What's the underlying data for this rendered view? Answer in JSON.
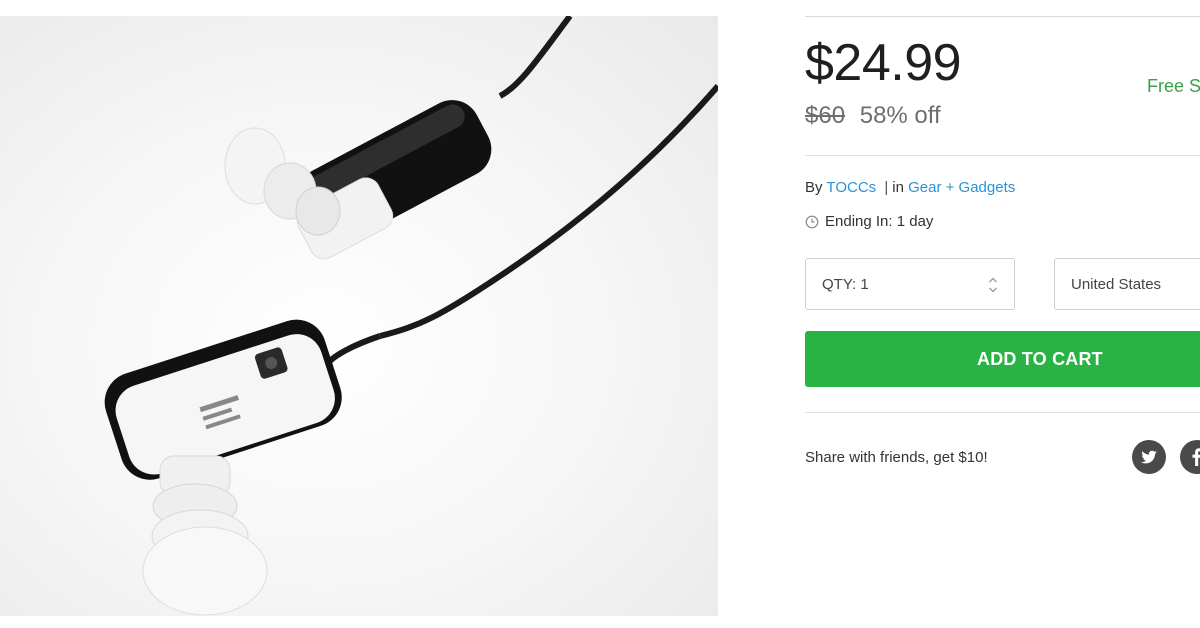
{
  "product": {
    "image_alt": "Bluetooth earbuds"
  },
  "pricing": {
    "price": "$24.99",
    "original_price": "$60",
    "discount": "58% off",
    "shipping": "Free Shipping"
  },
  "seller": {
    "by_prefix": "By",
    "vendor": "TOCCs",
    "separator": "|",
    "in_prefix": "in",
    "category": "Gear + Gadgets"
  },
  "ending": {
    "text": "Ending In: 1 day"
  },
  "quantity": {
    "label": "QTY: 1"
  },
  "country": {
    "label": "United States"
  },
  "cart": {
    "button_label": "ADD TO CART"
  },
  "share": {
    "text": "Share with friends, get $10!",
    "icons": [
      "twitter-icon",
      "facebook-icon"
    ]
  },
  "colors": {
    "accent_green": "#28b344",
    "link_blue": "#2a93d5",
    "shipping_green": "#3aa14a",
    "social_gray": "#4a4a4a"
  }
}
